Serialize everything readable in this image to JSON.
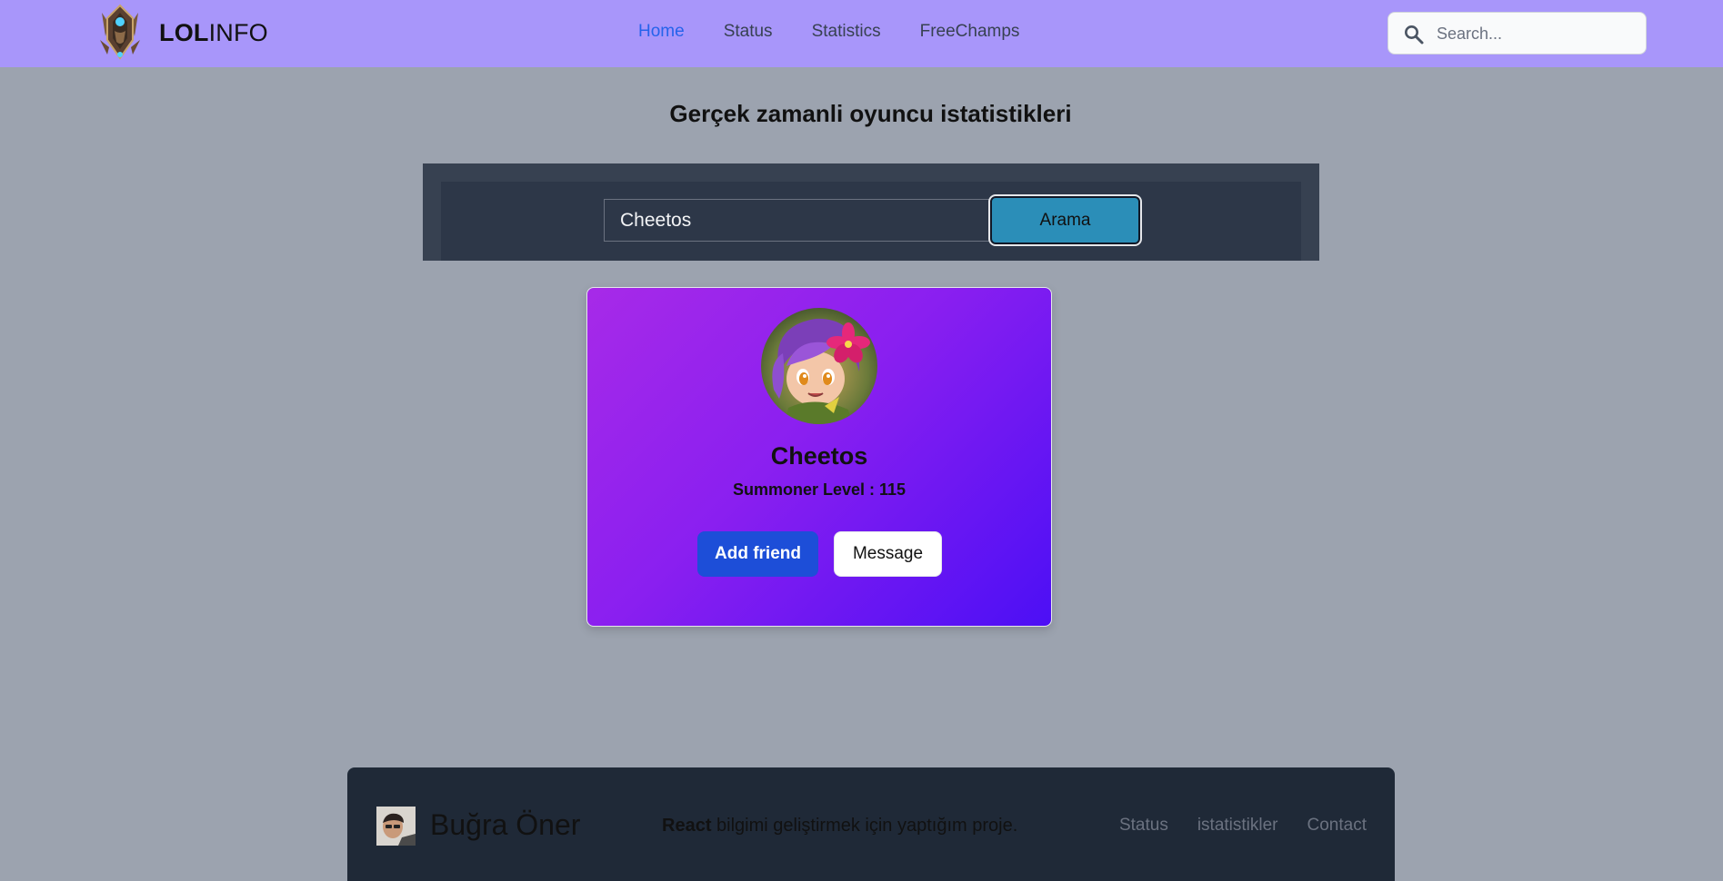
{
  "brand": {
    "bold": "LOL",
    "regular": "INFO"
  },
  "nav": {
    "items": [
      {
        "label": "Home",
        "active": true
      },
      {
        "label": "Status",
        "active": false
      },
      {
        "label": "Statistics",
        "active": false
      },
      {
        "label": "FreeChamps",
        "active": false
      }
    ]
  },
  "search": {
    "placeholder": "Search...",
    "icon": "search-icon"
  },
  "heading": "Gerçek zamanli oyuncu istatistikleri",
  "player_search": {
    "value": "Cheetos",
    "button_label": "Arama"
  },
  "profile": {
    "name": "Cheetos",
    "level_text": "Summoner Level : 115",
    "add_friend_label": "Add friend",
    "message_label": "Message"
  },
  "footer": {
    "name": "Buğra Öner",
    "desc_bold": "React",
    "desc_rest": " bilgimi geliştirmek için yaptığım proje.",
    "links": [
      "Status",
      "istatistikler",
      "Contact"
    ]
  },
  "colors": {
    "navbar": "#a896fa",
    "page_bg": "#9ca3af",
    "nav_active": "#2563eb",
    "arama_button": "#2b8eb8",
    "card_gradient_start": "#a72ae8",
    "card_gradient_end": "#4c0ff5",
    "add_friend_button": "#1d4ed8",
    "footer_bg": "#1f2937"
  }
}
